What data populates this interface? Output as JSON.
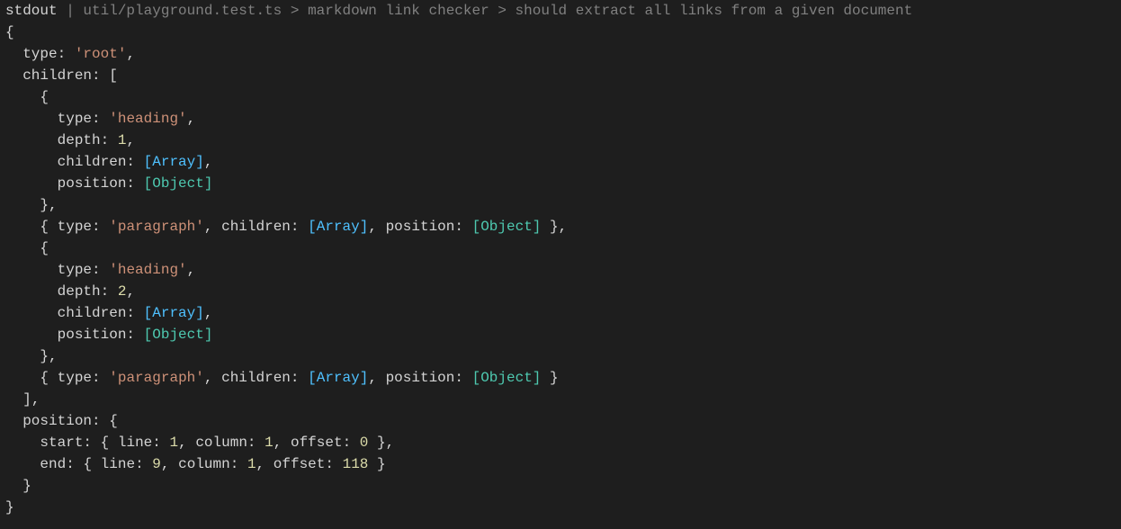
{
  "header": {
    "label": "stdout",
    "sep1": " | ",
    "path": "util/playground.test.ts",
    "sep2": " > ",
    "suite": "markdown link checker",
    "sep3": " > ",
    "test": "should extract all links from a given document"
  },
  "tokens": {
    "brace_open": "{",
    "brace_close": "}",
    "bracket_open": "[",
    "bracket_close": "]",
    "comma": ",",
    "colon": ":",
    "type": "type",
    "children": "children",
    "depth": "depth",
    "position": "position",
    "start": "start",
    "end": "end",
    "line": "line",
    "column": "column",
    "offset": "offset",
    "root": "'root'",
    "heading": "'heading'",
    "paragraph": "'paragraph'",
    "array_ref": "[Array]",
    "object_ref": "[Object]"
  },
  "values": {
    "depth1": "1",
    "depth2": "2",
    "start_line": "1",
    "start_column": "1",
    "start_offset": "0",
    "end_line": "9",
    "end_column": "1",
    "end_offset": "118"
  }
}
